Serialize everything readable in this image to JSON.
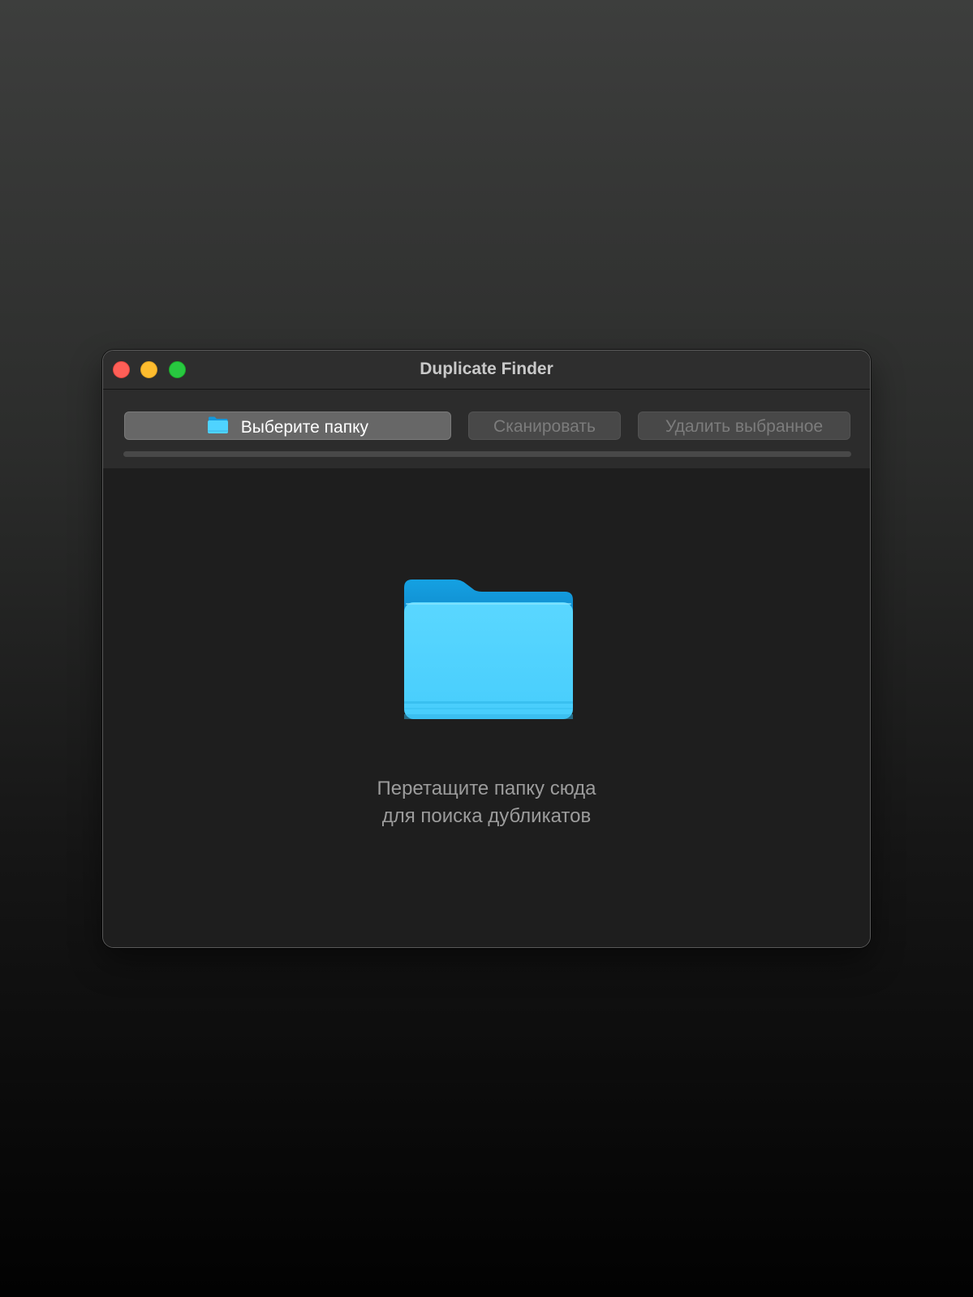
{
  "window": {
    "title": "Duplicate Finder"
  },
  "toolbar": {
    "choose_folder_label": "Выберите папку",
    "choose_folder_icon": "folder-icon",
    "scan_label": "Сканировать",
    "delete_selected_label": "Удалить выбранное",
    "progress": 0
  },
  "dropzone": {
    "icon": "folder-icon",
    "hint_line1": "Перетащите папку сюда",
    "hint_line2": "для поиска дубликатов"
  },
  "colors": {
    "folder_light": "#4fd3ff",
    "folder_dark": "#1499dc",
    "close": "#fe5f57",
    "minimize": "#febc2e",
    "zoom": "#28c840"
  }
}
